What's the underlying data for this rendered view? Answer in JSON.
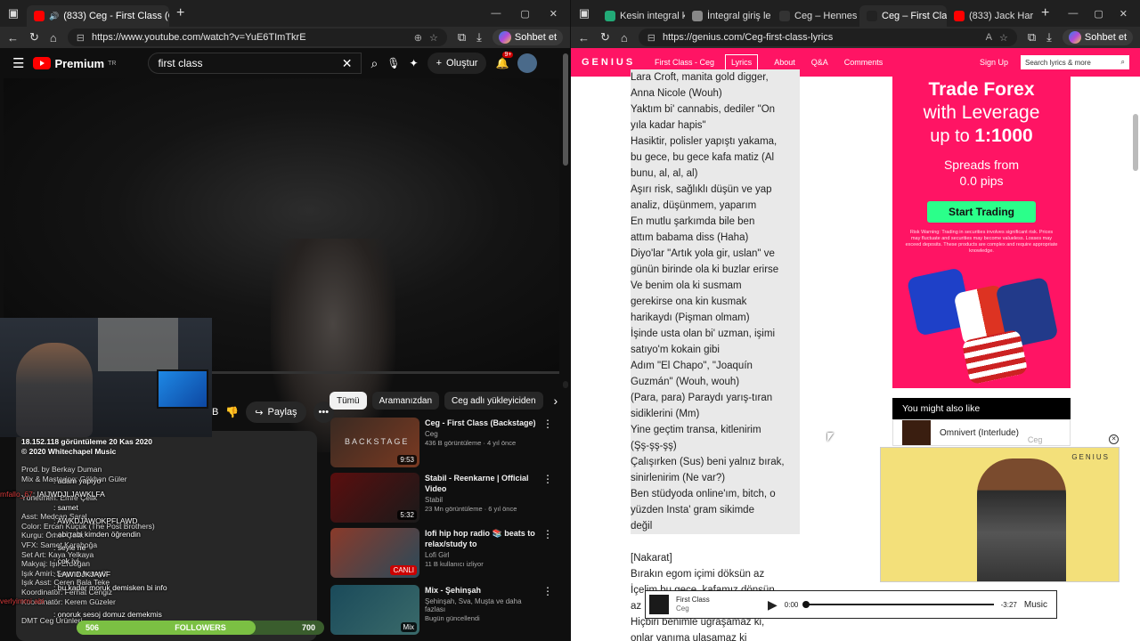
{
  "left_window": {
    "tabs": [
      {
        "title": "(833) Ceg - First Class (Offic",
        "active": true
      }
    ],
    "url": "https://www.youtube.com/watch?v=YuE6TImTkrE",
    "copilot_label": "Sohbet et"
  },
  "youtube": {
    "logo": "Premium",
    "logo_sup": "TR",
    "search_value": "first class",
    "create_label": "Oluştur",
    "notif_count": "9+",
    "like_count_partial": "B",
    "share_label": "Paylaş",
    "chips": [
      "Tümü",
      "Aramanızdan",
      "Ceg adlı yükleyiciden"
    ],
    "description": {
      "views": "18.152.118 görüntüleme  20 Kas 2020",
      "copyright": "© 2020 Whitechapel Music",
      "credits": [
        "Prod. by Berkay Duman",
        "Mix & Mastering: Gökhan Güler",
        "",
        "Yönetmen: Emre Çelik",
        "",
        "Asst: Medcan Saral",
        "Color: Ercan Küçük (The Post Brothers)",
        "Kurgu: Ömer Çelik",
        "VFX: Samet Karaboğa",
        "Set Art: Kaya Yelkaya",
        "Makyaj: Işıl Erdoğan",
        "Işık Amiri: Şeyma Arangül",
        "Işık Asst: Ceren Bala Teke",
        "Koordinatör: Ferhat Cengiz",
        "Koordinatör: Kerem Güzeler",
        "",
        "DMT Ceg Ürünleri"
      ]
    },
    "recommendations": [
      {
        "title": "Ceg - First Class (Backstage)",
        "channel": "Ceg",
        "meta": "436 B görüntüleme · 4 yıl önce",
        "badge": "9:53",
        "thumb_text": "BACKSTAGE"
      },
      {
        "title": "Stabil - Reenkarne | Official Video",
        "channel": "Stabil",
        "meta": "23 Mn görüntüleme · 6 yıl önce",
        "badge": "5:32",
        "thumb_text": ""
      },
      {
        "title": "lofi hip hop radio 📚 beats to relax/study to",
        "channel": "Lofi Girl",
        "meta": "11 B kullanıcı izliyor",
        "badge": "CANLI",
        "thumb_text": ""
      },
      {
        "title": "Mix - Şehinşah",
        "channel": "Şehinşah, Sva, Muşta ve daha fazlası",
        "meta": "Bugün güncellendi",
        "badge": "Mix",
        "thumb_text": ""
      }
    ]
  },
  "stream_overlay": {
    "chat": [
      {
        "name": "",
        "text": ": adam yapıyo"
      },
      {
        "name": "mfallo_67",
        "text": ": IAIJWDJLJAWKLFA"
      },
      {
        "name": "",
        "text": ": samet"
      },
      {
        "name": "",
        "text": ": AWKDJAWOKPFLAWD"
      },
      {
        "name": "",
        "text": ": abi rabi kimden öğrendin"
      },
      {
        "name": "",
        "text": ": seyle ne"
      },
      {
        "name": "",
        "text": ": çok iyi"
      },
      {
        "name": "",
        "text": ": LAWIDJKJAWF"
      },
      {
        "name": "",
        "text": ": bu kadar moruk demisken bi info"
      },
      {
        "name": "verlyimmi abi",
        "text": ""
      },
      {
        "name": "",
        "text": ": onoruk sesoj domuz demekmis"
      }
    ],
    "followers": {
      "label": "FOLLOWERS",
      "current": "506",
      "goal": "700",
      "progress": 0.723
    }
  },
  "right_window": {
    "tabs": [
      {
        "title": "Kesin integral k",
        "active": false
      },
      {
        "title": "İntegral giriş le",
        "active": false
      },
      {
        "title": "Ceg – Hennes",
        "active": false
      },
      {
        "title": "Ceg – First Cla",
        "active": true
      },
      {
        "title": "(833) Jack Har",
        "active": false
      }
    ],
    "url": "https://genius.com/Ceg-first-class-lyrics",
    "copilot_label": "Sohbet et"
  },
  "genius": {
    "logo": "GENIUS",
    "song_link": "First Class - Ceg",
    "nav": [
      "Lyrics",
      "About",
      "Q&A",
      "Comments"
    ],
    "signup": "Sign Up",
    "search_placeholder": "Search lyrics & more",
    "lyrics": [
      "Lara Croft, manita gold digger,",
      "Anna Nicole (Wouh)",
      "Yaktım bi' cannabis, dediler \"On",
      "yıla kadar hapis\"",
      "Hasiktir, polisler yapıştı yakama,",
      "bu gece, bu gece kafa matiz (Al",
      "bunu, al, al, al)",
      "Aşırı risk, sağlıklı düşün ve yap",
      "analiz, düşünmem, yaparım",
      "En mutlu şarkımda bile ben",
      "attım babama diss (Haha)",
      "Diyo'lar \"Artık yola gir, uslan\" ve",
      "günün birinde ola ki buzlar erirse",
      "Ve benim ola ki susmam",
      "gerekirse ona kin kusmak",
      "harikaydı (Pişman olmam)",
      "İşinde usta olan bi' uzman, işimi",
      "satıyo'm kokain gibi",
      "Adım \"El Chapo\", \"Joaquín",
      "Guzmán\" (Wouh, wouh)",
      "(Para, para) Paraydı yarış-tıran",
      "sidiklerini (Mm)",
      "Yine geçtim transa, kitlenirim",
      "(Şş-şş-şş)",
      "Çalışırken (Sus) beni yalnız bırak,",
      "sinirlenirim (Ne var?)",
      "Ben stüdyoda online'ım, bitch, o",
      "yüzden Insta' gram sikimde",
      "değil",
      "",
      "[Nakarat]",
      "Bırakın egom içimi döksün az",
      "İçelim bu gece, kafamız dönsün",
      "az",
      "Hiçbiri benimle uğraşamaz ki,",
      "onlar yanıma ulaşamaz ki"
    ],
    "ad": {
      "headline1": "Trade Forex",
      "headline2": "with Leverage",
      "headline3": "up to ",
      "leverage": "1:1000",
      "spreads1": "Spreads from",
      "spreads2": "0.0 pips",
      "cta": "Start Trading",
      "risk": "Risk Warning: Trading in securities involves significant risk. Prices may fluctuate and securities may become valueless. Losses may exceed deposits. These products are complex and require appropriate knowledge."
    },
    "you_might_like": {
      "title": "You might also like",
      "item": "Omnivert (Interlude)",
      "item_artist": "Ceg"
    },
    "pip_logo": "GENIUS",
    "player": {
      "title": "First Class",
      "artist": "Ceg",
      "time_start": "0:00",
      "time_end": "-3:27",
      "service": "Music",
      "progress": 0
    }
  },
  "colors": {
    "genius_pink": "#ff1464",
    "youtube_red": "#ff0000",
    "ad_button": "#2bff8a"
  }
}
